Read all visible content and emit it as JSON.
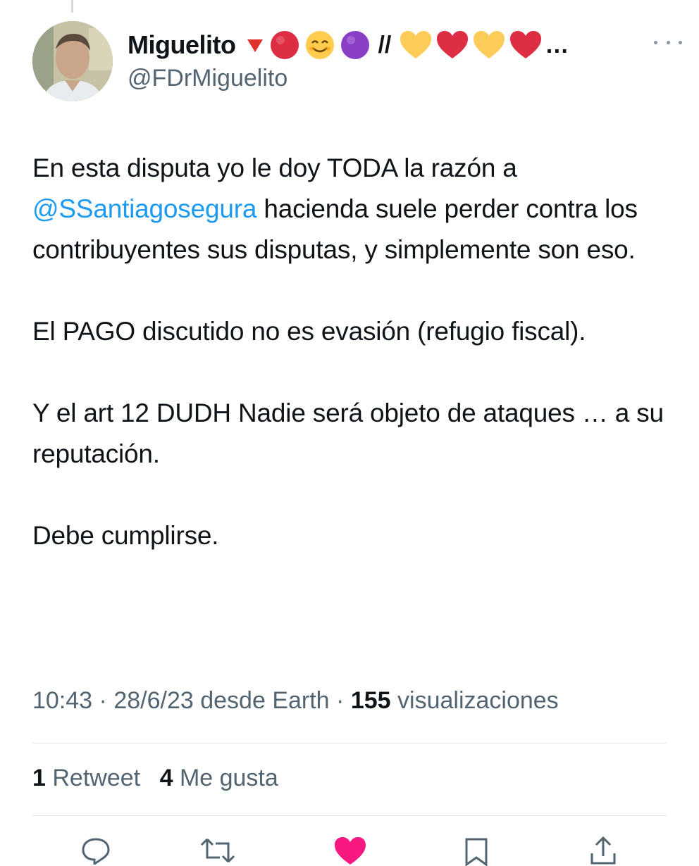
{
  "tweet": {
    "author": {
      "display_name": "Miguelito",
      "name_emoji": [
        "🔻",
        "🔴",
        "😊",
        "🟣",
        "//",
        "💛",
        "❤️",
        "💛",
        "❤️",
        "…"
      ],
      "handle": "@FDrMiguelito"
    },
    "body": {
      "p1_before": "En esta disputa yo le doy TODA la razón a ",
      "p1_mention": "@SSantiagosegura",
      "p1_after": " hacienda suele perder contra los contribuyentes sus disputas, y simplemente son eso.",
      "p2": "El PAGO discutido no es evasión (refugio fiscal).",
      "p3": "Y el art 12  DUDH Nadie será objeto de ataques … a su reputación.",
      "p4": "Debe cumplirse."
    },
    "meta": {
      "time": "10:43",
      "date": "28/6/23",
      "source": "desde Earth",
      "sep": "·",
      "views_count": "155",
      "views_label": "visualizaciones"
    },
    "stats": {
      "retweets_count": "1",
      "retweets_label": "Retweet",
      "likes_count": "4",
      "likes_label": "Me gusta"
    },
    "actions": [
      "reply-icon",
      "retweet-icon",
      "like-icon",
      "bookmark-icon",
      "share-icon"
    ]
  },
  "colors": {
    "text": "#0f1419",
    "secondary": "#536471",
    "link": "#1d9bf0",
    "like": "#f91880",
    "divider": "#e1e5e8"
  }
}
